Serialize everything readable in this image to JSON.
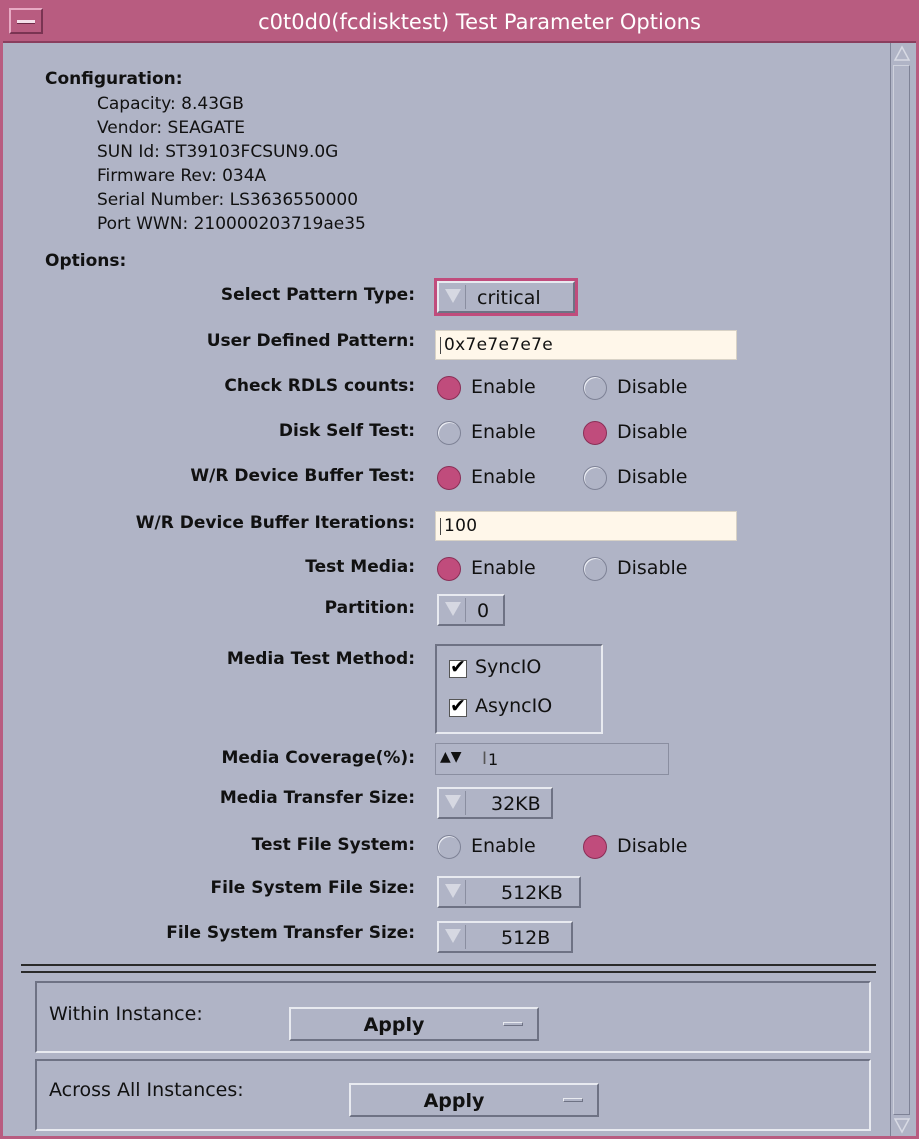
{
  "window": {
    "title": "c0t0d0(fcdisktest) Test Parameter Options"
  },
  "configuration": {
    "heading": "Configuration:",
    "lines": [
      "Capacity: 8.43GB",
      "Vendor: SEAGATE",
      "SUN Id: ST39103FCSUN9.0G",
      "Firmware Rev: 034A",
      "Serial Number: LS3636550000",
      "Port WWN: 210000203719ae35"
    ]
  },
  "options": {
    "heading": "Options:",
    "select_pattern_type": {
      "label": "Select Pattern Type:",
      "value": "critical"
    },
    "user_defined_pattern": {
      "label": "User Defined Pattern:",
      "value": "0x7e7e7e7e"
    },
    "check_rdls_counts": {
      "label": "Check RDLS counts:",
      "enable": "Enable",
      "disable": "Disable",
      "selected": "Enable"
    },
    "disk_self_test": {
      "label": "Disk Self Test:",
      "enable": "Enable",
      "disable": "Disable",
      "selected": "Disable"
    },
    "wr_device_buffer_test": {
      "label": "W/R Device Buffer Test:",
      "enable": "Enable",
      "disable": "Disable",
      "selected": "Enable"
    },
    "wr_device_buffer_iterations": {
      "label": "W/R Device Buffer Iterations:",
      "value": "100"
    },
    "test_media": {
      "label": "Test Media:",
      "enable": "Enable",
      "disable": "Disable",
      "selected": "Enable"
    },
    "partition": {
      "label": "Partition:",
      "value": "0"
    },
    "media_test_method": {
      "label": "Media Test Method:",
      "sync": "SyncIO",
      "async": "AsyncIO",
      "sync_checked": true,
      "async_checked": true
    },
    "media_coverage": {
      "label": "Media Coverage(%):",
      "value": "1"
    },
    "media_transfer_size": {
      "label": "Media Transfer Size:",
      "value": "32KB"
    },
    "test_file_system": {
      "label": "Test File System:",
      "enable": "Enable",
      "disable": "Disable",
      "selected": "Disable"
    },
    "file_system_file_size": {
      "label": "File System File Size:",
      "value": "512KB"
    },
    "file_system_transfer_size": {
      "label": "File System Transfer Size:",
      "value": "512B"
    }
  },
  "apply": {
    "within_instance": {
      "label": "Within Instance:",
      "button": "Apply"
    },
    "across_all_instances": {
      "label": "Across All Instances:",
      "button": "Apply"
    }
  },
  "colors": {
    "accent": "#b85c80",
    "background": "#b0b4c6",
    "radio_selected": "#c04c7c",
    "field_background": "#fff7ea"
  }
}
